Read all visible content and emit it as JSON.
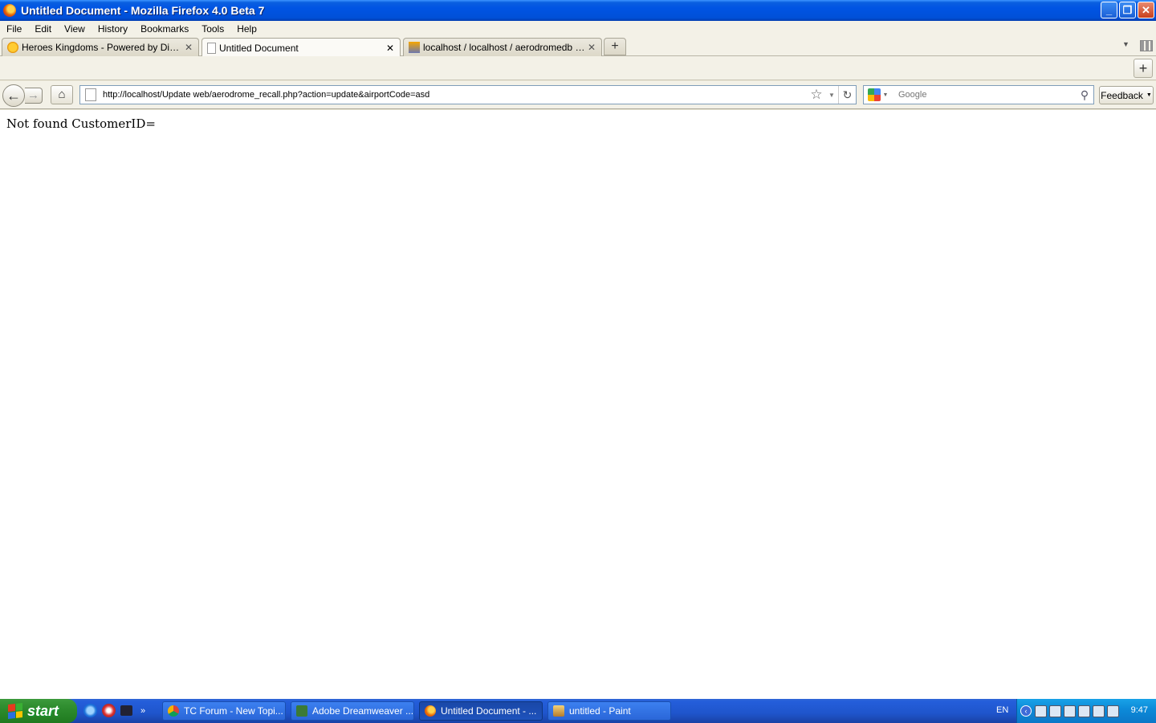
{
  "window": {
    "title": "Untitled Document - Mozilla Firefox 4.0 Beta 7"
  },
  "menu": [
    "File",
    "Edit",
    "View",
    "History",
    "Bookmarks",
    "Tools",
    "Help"
  ],
  "tabs": [
    {
      "label": "Heroes Kingdoms - Powered by Discuz!",
      "icon": "discuz-icon",
      "active": false
    },
    {
      "label": "Untitled Document",
      "icon": "page-icon",
      "active": true
    },
    {
      "label": "localhost / localhost / aerodromedb / aer...",
      "icon": "phpmyadmin-icon",
      "active": false
    }
  ],
  "navbar": {
    "url": "http://localhost/Update web/aerodrome_recall.php?action=update&airportCode=asd",
    "search_placeholder": "Google",
    "feedback_label": "Feedback"
  },
  "page": {
    "text": "Not found CustomerID="
  },
  "taskbar": {
    "start_label": "start",
    "tasks": [
      {
        "label": "TC Forum - New Topi...",
        "icon": "chrome-icon",
        "active": false
      },
      {
        "label": "Adobe Dreamweaver ...",
        "icon": "dreamweaver-icon",
        "active": false
      },
      {
        "label": "Untitled Document - ...",
        "icon": "firefox-icon",
        "active": true
      },
      {
        "label": "untitled - Paint",
        "icon": "paint-icon",
        "active": false
      }
    ],
    "language": "EN",
    "clock": "9:47"
  },
  "colors": {
    "titlebar": "#0054e3",
    "taskbar": "#245edb",
    "start": "#2d8b2d"
  }
}
